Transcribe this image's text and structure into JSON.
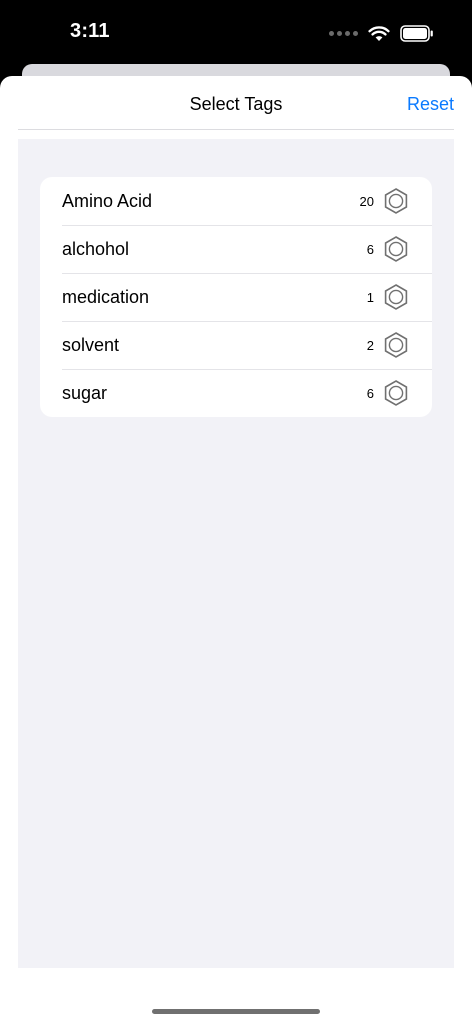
{
  "status_bar": {
    "time": "3:11",
    "icons": [
      "signal-dots-icon",
      "wifi-icon",
      "battery-icon"
    ]
  },
  "sheet": {
    "title": "Select Tags",
    "reset_label": "Reset"
  },
  "tags": [
    {
      "name": "Amino Acid",
      "count": "20",
      "icon": "benzene-ring-icon"
    },
    {
      "name": "alchohol",
      "count": "6",
      "icon": "benzene-ring-icon"
    },
    {
      "name": "medication",
      "count": "1",
      "icon": "benzene-ring-icon"
    },
    {
      "name": "solvent",
      "count": "2",
      "icon": "benzene-ring-icon"
    },
    {
      "name": "sugar",
      "count": "6",
      "icon": "benzene-ring-icon"
    }
  ],
  "colors": {
    "accent": "#0a7aff",
    "grouped_background": "#f2f2f7",
    "icon_stroke": "#707070"
  }
}
